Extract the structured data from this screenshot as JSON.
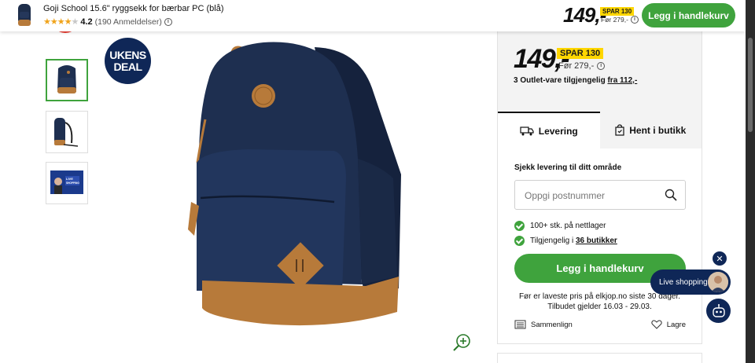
{
  "sticky_header": {
    "product_title": "Goji School 15.6\" ryggsekk for bærbar PC (blå)",
    "rating_value": "4.2",
    "rating_count": "(190 Anmeldelser)",
    "rating_stars": 4.2,
    "price": "149,-",
    "save_badge": "SPAR 130",
    "before_price": "Før 279,-",
    "cart_button": "Legg i handlekurv"
  },
  "gallery": {
    "deal_badge_line1": "UKENS",
    "deal_badge_line2": "DEAL",
    "thumbnail_count": 3,
    "thumb3_text": "LIVE SHOPPING"
  },
  "purchase_panel": {
    "price": "149,-",
    "save_badge": "SPAR 130",
    "before_price": "Før 279,-",
    "outlet_text": "3 Outlet-vare tilgjengelig ",
    "outlet_link": "fra 112,-",
    "tabs": [
      {
        "label": "Levering",
        "icon": "truck-icon",
        "active": true
      },
      {
        "label": "Hent i butikk",
        "icon": "store-bag-icon",
        "active": false
      }
    ],
    "check_delivery_label": "Sjekk levering til ditt område",
    "postal_placeholder": "Oppgi postnummer",
    "stock_online": "100+ stk. på nettlager",
    "stock_stores_prefix": "Tilgjengelig i ",
    "stock_stores_link": "36 butikker",
    "cart_button": "Legg i handlekurv",
    "lowest_price_note": "Før er laveste pris på elkjop.no siste 30 dager.",
    "offer_valid": "Tilbudet gjelder 16.03 - 29.03.",
    "compare_label": "Sammenlign",
    "save_label": "Lagre"
  },
  "floating": {
    "close_symbol": "✕",
    "live_shopping_label": "Live shopping"
  },
  "colors": {
    "green": "#3fa33d",
    "navy": "#0f2757",
    "yellow_badge": "#ffd600",
    "star": "#f0a41c",
    "sale_red": "#e8392e"
  }
}
